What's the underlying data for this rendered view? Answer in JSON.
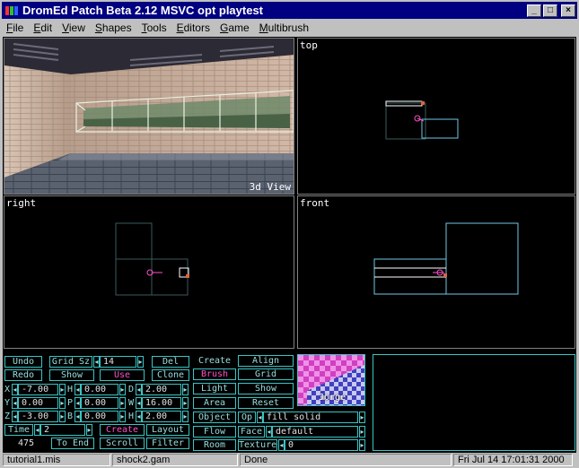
{
  "window": {
    "title": "DromEd Patch Beta 2.12 MSVC opt playtest",
    "controls": {
      "minimize": "_",
      "maximize": "□",
      "close": "×"
    }
  },
  "menu": [
    "File",
    "Edit",
    "View",
    "Shapes",
    "Tools",
    "Editors",
    "Game",
    "Multibrush"
  ],
  "viewports": {
    "view3d": "3d View",
    "top": "top",
    "right": "right",
    "front": "front"
  },
  "panel": {
    "undo": "Undo",
    "redo": "Redo",
    "grid_sz_label": "Grid Sz",
    "grid_sz_value": "14",
    "show": "Show",
    "use": "Use",
    "del": "Del",
    "clone": "Clone",
    "coords": [
      {
        "axis": "X",
        "value": "-7.00",
        "rot": "H",
        "rot_value": "0.00",
        "dim": "D",
        "dim_value": "2.00"
      },
      {
        "axis": "Y",
        "value": "0.00",
        "rot": "P",
        "rot_value": "0.00",
        "dim": "W",
        "dim_value": "16.00"
      },
      {
        "axis": "Z",
        "value": "-3.00",
        "rot": "B",
        "rot_value": "0.00",
        "dim": "H",
        "dim_value": "2.00"
      }
    ],
    "time_label": "Time",
    "time_value": "2",
    "create_pink": "Create",
    "layout": "Layout",
    "counter": "475",
    "to_end": "To End",
    "scroll": "Scroll",
    "filter": "Filter",
    "mid_col": [
      "Create",
      "Brush",
      "Light",
      "Area",
      "Object",
      "Flow",
      "Room"
    ],
    "right_col": [
      "Align",
      "Grid",
      "Show",
      "Reset"
    ],
    "op_label": "Op",
    "op_value": "fill solid",
    "face_label": "Face",
    "face_value": "default",
    "texture_label": "Texture",
    "texture_value": "0",
    "texture_name": "Jorge"
  },
  "status": {
    "mission": "tutorial1.mis",
    "gamesys": "shock2.gam",
    "state": "Done",
    "datetime": "Fri Jul 14 17:01:31 2000"
  },
  "colors": {
    "title_bg": "#000080",
    "panel_text": "#9adede",
    "panel_border": "#3ac4c4",
    "accent_pink": "#ff4fc8",
    "brush_cyan": "#6fc7e6",
    "brush_grid": "#3a5a5a"
  },
  "icons": {
    "app": "dromed-app-icon",
    "left_arrow": "left-arrow-icon",
    "right_arrow": "right-arrow-icon"
  }
}
